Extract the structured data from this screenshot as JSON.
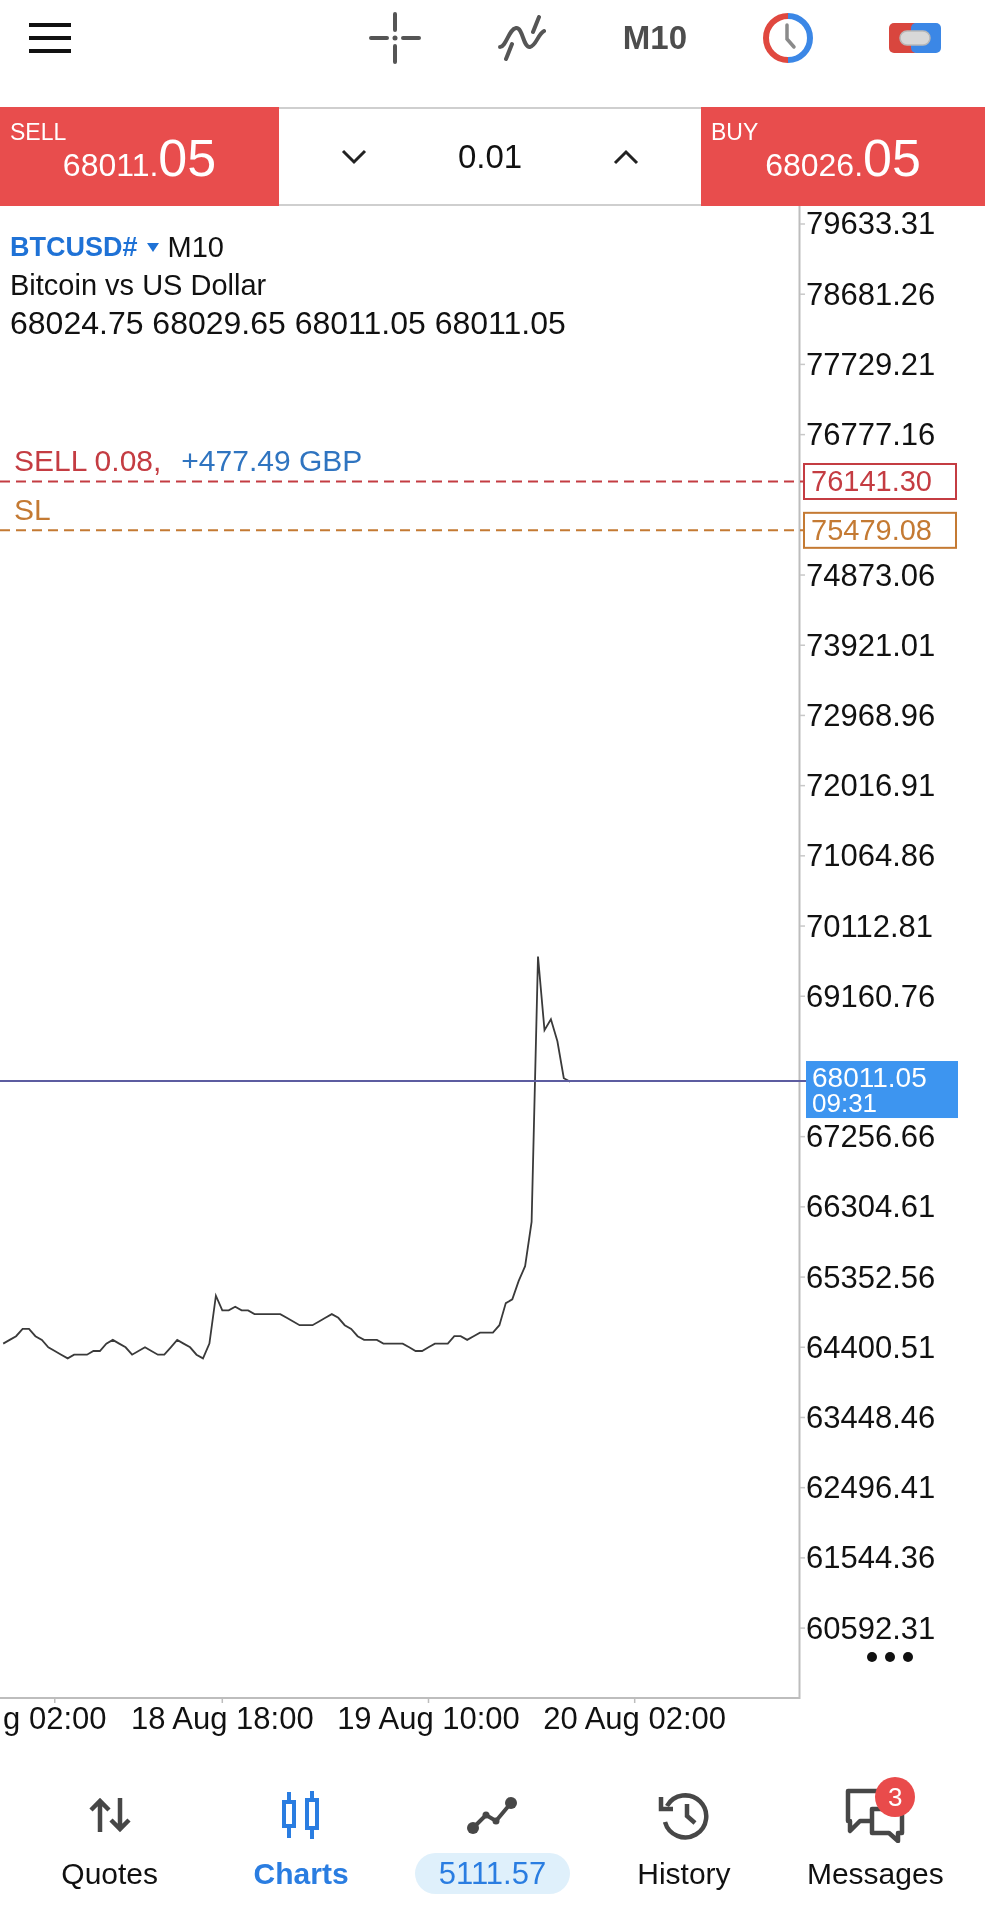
{
  "toolbar": {
    "timeframe": "M10"
  },
  "trade": {
    "sell": {
      "label": "SELL",
      "price": "68011.",
      "pips": "05"
    },
    "lot": "0.01",
    "buy": {
      "label": "BUY",
      "price": "68026.",
      "pips": "05"
    }
  },
  "chart": {
    "symbol": "BTCUSD#",
    "timeframe": "M10",
    "description": "Bitcoin vs US Dollar",
    "ohlc": "68024.75 68029.65 68011.05 68011.05",
    "trade_lines": [
      {
        "kind": "position",
        "label": "SELL 0.08,",
        "profit": "+477.49 GBP"
      },
      {
        "kind": "stop_loss",
        "label": "SL"
      },
      {
        "kind": "bid",
        "time": "09:31"
      }
    ],
    "chart_data": {
      "type": "line",
      "categories": [
        null,
        null,
        null,
        null,
        null,
        null,
        null,
        null,
        "g 02:00",
        null,
        null,
        null,
        null,
        null,
        null,
        null,
        null,
        null,
        null,
        null,
        null,
        null,
        null,
        null,
        null,
        null,
        null,
        null,
        null,
        null,
        null,
        null,
        null,
        null,
        "18 Aug 18:00",
        null,
        null,
        null,
        null,
        null,
        null,
        null,
        null,
        null,
        null,
        null,
        null,
        null,
        null,
        null,
        null,
        null,
        null,
        null,
        null,
        null,
        null,
        null,
        null,
        null,
        null,
        null,
        null,
        null,
        null,
        null,
        "19 Aug 10:00",
        null,
        null,
        null,
        null,
        null,
        null,
        null,
        null,
        null,
        null,
        null,
        null,
        null,
        null,
        null,
        null,
        null,
        null,
        null,
        null,
        null,
        null,
        null,
        null,
        null,
        null,
        null,
        null,
        null,
        null,
        null,
        "20 Aug 02:00",
        null,
        null,
        null,
        null,
        null,
        null,
        null,
        null,
        null,
        null,
        null,
        null,
        null,
        null,
        null,
        null,
        null,
        null,
        null,
        null,
        null,
        null,
        null,
        null,
        null
      ],
      "series": [
        {
          "color": "#3a3a3a",
          "values": [
            64450,
            64500,
            64550,
            64650,
            64650,
            64550,
            64500,
            64400,
            64350,
            64300,
            64250,
            64300,
            64300,
            64300,
            64350,
            64350,
            64450,
            64500,
            64450,
            64400,
            64300,
            64350,
            64400,
            64350,
            64300,
            64300,
            64400,
            64500,
            64450,
            64400,
            64300,
            64250,
            64450,
            65100,
            64900,
            64900,
            64950,
            64900,
            64900,
            64850,
            64850,
            64850,
            64850,
            64850,
            64800,
            64750,
            64700,
            64700,
            64700,
            64750,
            64800,
            64850,
            64800,
            64700,
            64650,
            64550,
            64500,
            64500,
            64500,
            64450,
            64450,
            64450,
            64450,
            64400,
            64350,
            64350,
            64400,
            64450,
            64450,
            64450,
            64550,
            64550,
            64500,
            64550,
            64600,
            64600,
            64600,
            64700,
            65000,
            65050,
            65300,
            65500,
            66100,
            69700,
            68700,
            68850,
            68550,
            68050,
            68000,
            null,
            null,
            null,
            null,
            null,
            null,
            null,
            null,
            null,
            null,
            null,
            null,
            null,
            null,
            null,
            null,
            null,
            null,
            null,
            null,
            null,
            null,
            null,
            null,
            null,
            null,
            null,
            null,
            null,
            null,
            null,
            null,
            null,
            null,
            null
          ]
        }
      ],
      "ylim": [
        59644.1,
        79877.4
      ],
      "yticks": [
        79633.31,
        78681.26,
        77729.21,
        76777.16,
        74873.06,
        73921.01,
        72968.96,
        72016.91,
        71064.86,
        70112.81,
        69160.76,
        67256.66,
        66304.61,
        65352.56,
        64400.51,
        63448.46,
        62496.41,
        61544.36,
        60592.31
      ],
      "ref_lines": [
        {
          "axis": "y",
          "value": 76141.3,
          "label": "76141.30",
          "color": "#c43c42"
        },
        {
          "axis": "y",
          "value": 75479.08,
          "label": "75479.08",
          "color": "#c47a33"
        },
        {
          "axis": "y",
          "value": 68011.05,
          "label": "68011.05",
          "color": "#5c5ca0"
        }
      ]
    }
  },
  "nav": {
    "items": [
      {
        "kind": "tab",
        "label": "Quotes",
        "selected": false
      },
      {
        "kind": "tab",
        "label": "Charts",
        "selected": true
      },
      {
        "kind": "balance",
        "label": "5111.57",
        "selected": false
      },
      {
        "kind": "tab",
        "label": "History",
        "selected": false
      },
      {
        "kind": "tab",
        "label": "Messages",
        "selected": false,
        "badge": "3"
      }
    ]
  }
}
